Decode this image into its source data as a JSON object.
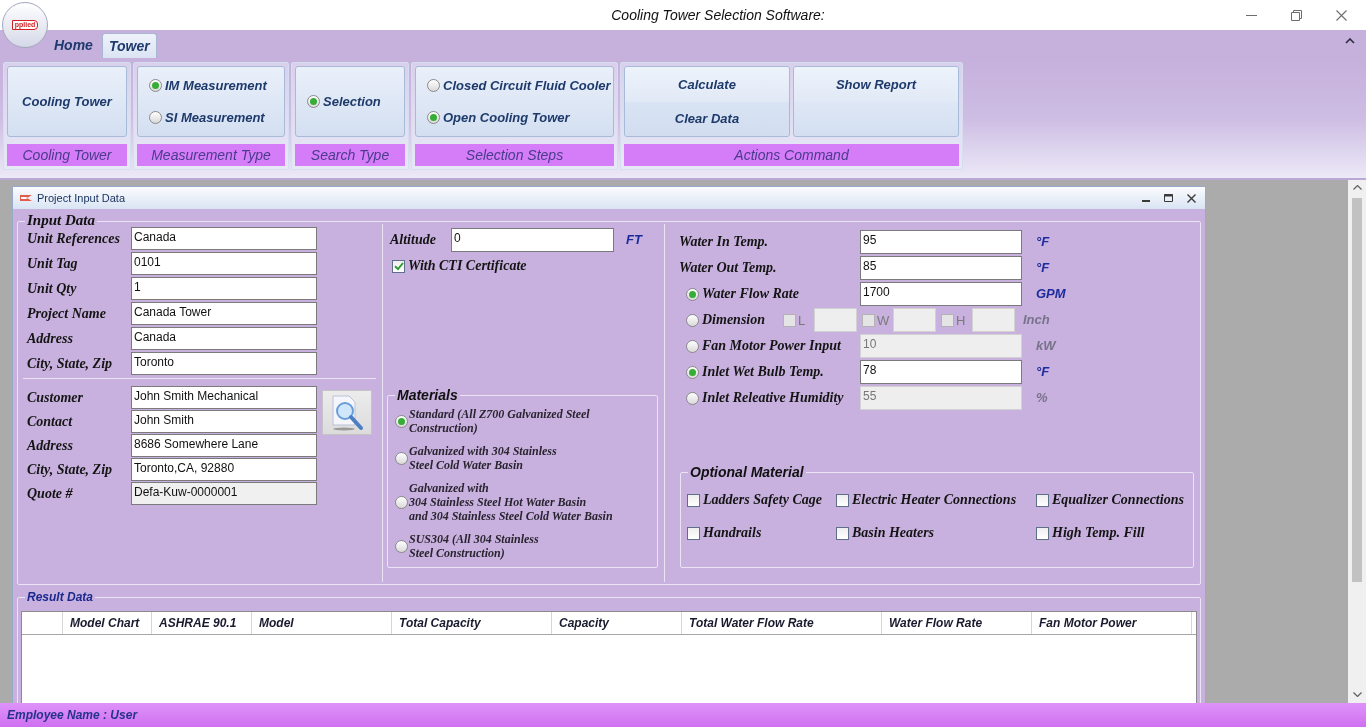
{
  "window": {
    "title": "Cooling Tower Selection Software:",
    "logo_text": "pplied"
  },
  "ribbon": {
    "tabs": [
      {
        "label": "Home",
        "selected": false
      },
      {
        "label": "Tower",
        "selected": true
      }
    ],
    "groups": [
      {
        "kind": "large_button",
        "label": "Cooling Tower",
        "panels": [
          {
            "items": [
              {
                "label": "Cooling Tower"
              }
            ]
          }
        ]
      },
      {
        "kind": "radio_list",
        "label": "Measurement Type",
        "panels": [
          {
            "items": [
              {
                "label": "IM Measurement",
                "selected": true
              },
              {
                "label": "SI Measurement",
                "selected": false
              }
            ]
          }
        ]
      },
      {
        "kind": "radio_list",
        "label": "Search Type",
        "panels": [
          {
            "items": [
              {
                "label": "Selection",
                "selected": true
              }
            ]
          }
        ]
      },
      {
        "kind": "radio_list",
        "label": "Selection Steps",
        "panels": [
          {
            "items": [
              {
                "label": "Closed Circuit Fluid Cooler",
                "selected": false
              },
              {
                "label": "Open Cooling Tower",
                "selected": true
              }
            ]
          }
        ]
      },
      {
        "kind": "action_buttons",
        "label": "Actions Command",
        "panels": [
          {
            "items": [
              {
                "label": "Calculate"
              },
              {
                "label": "Clear Data"
              }
            ]
          },
          {
            "items": [
              {
                "label": "Show Report"
              }
            ]
          }
        ]
      }
    ]
  },
  "project_window": {
    "title": "Project Input Data"
  },
  "input_data": {
    "title": "Input Data",
    "unit_fields": [
      {
        "label": "Unit References",
        "value": "Canada"
      },
      {
        "label": "Unit Tag",
        "value": "0101"
      },
      {
        "label": "Unit Qty",
        "value": "1"
      },
      {
        "label": "Project Name",
        "value": "Canada Tower"
      },
      {
        "label": "Address",
        "value": "Canada"
      },
      {
        "label": "City, State, Zip",
        "value": "Toronto"
      }
    ],
    "customer_fields": [
      {
        "label": "Customer",
        "value": "John Smith Mechanical",
        "read_only": false
      },
      {
        "label": "Contact",
        "value": "John Smith",
        "read_only": false
      },
      {
        "label": "Address",
        "value": "8686 Somewhere Lane",
        "read_only": false
      },
      {
        "label": "City, State, Zip",
        "value": "Toronto,CA, 92880",
        "read_only": false
      },
      {
        "label": "Quote #",
        "value": "Defa-Kuw-0000001",
        "read_only": true
      }
    ],
    "altitude": {
      "label": "Altitude",
      "value": "0",
      "unit": "FT"
    },
    "cti_certificate": {
      "label": "With CTI Certificate",
      "checked": true
    },
    "materials": {
      "title": "Materials",
      "options": [
        {
          "label": "Standard (All Z700 Galvanized Steel\nConstruction)",
          "selected": true
        },
        {
          "label": "Galvanized with 304 Stainless\n Steel Cold Water Basin",
          "selected": false
        },
        {
          "label": "Galvanized with\n304 Stainless  Steel Hot Water Basin\nand 304 Stainless Steel Cold Water Basin",
          "selected": false
        },
        {
          "label": "SUS304 (All 304 Stainless\nSteel Construction)",
          "selected": false
        }
      ]
    },
    "conditions": [
      {
        "kind": "field",
        "label": "Water In Temp.",
        "value": "95",
        "unit": "°F",
        "disabled": false
      },
      {
        "kind": "field",
        "label": "Water Out Temp.",
        "value": "85",
        "unit": "°F",
        "disabled": false
      },
      {
        "kind": "radio_field",
        "label": "Water Flow Rate",
        "selected": true,
        "value": "1700",
        "unit": "GPM",
        "disabled": false
      },
      {
        "kind": "dimension",
        "label": "Dimension",
        "selected": false,
        "dims": [
          {
            "label": "L",
            "checked": false
          },
          {
            "label": "W",
            "checked": false
          },
          {
            "label": "H",
            "checked": false
          }
        ],
        "unit": "Inch",
        "disabled": true
      },
      {
        "kind": "radio_field",
        "label": "Fan Motor Power Input",
        "selected": false,
        "value": "10",
        "unit": "kW",
        "disabled": true
      },
      {
        "kind": "radio_field",
        "label": "Inlet Wet Bulb Temp.",
        "selected": true,
        "value": "78",
        "unit": "°F",
        "disabled": false
      },
      {
        "kind": "radio_field",
        "label": "Inlet Releative Humidity",
        "selected": false,
        "value": "55",
        "unit": "%",
        "disabled": true
      }
    ],
    "optional_material": {
      "title": "Optional Material",
      "options": [
        {
          "label": "Ladders Safety Cage",
          "checked": false
        },
        {
          "label": "Electric Heater Connections",
          "checked": false
        },
        {
          "label": "Equalizer Connections",
          "checked": false
        },
        {
          "label": "Handrails",
          "checked": false
        },
        {
          "label": "Basin Heaters",
          "checked": false
        },
        {
          "label": "High Temp. Fill",
          "checked": false
        }
      ]
    }
  },
  "result_data": {
    "title": "Result Data",
    "columns": [
      "Model Chart",
      "ASHRAE 90.1",
      "Model",
      "Total Capacity",
      "Capacity",
      "Total Water Flow Rate",
      "Water Flow Rate",
      "Fan Motor Power"
    ]
  },
  "status_bar": {
    "text": "Employee Name : User"
  }
}
